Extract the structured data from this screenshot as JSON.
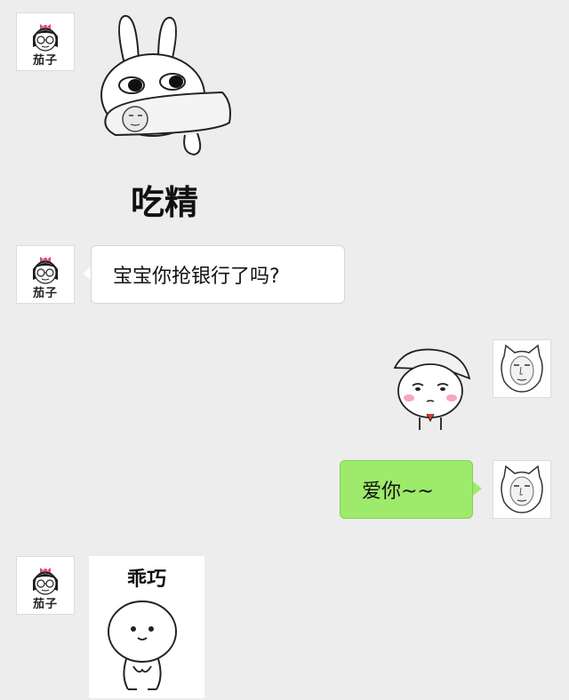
{
  "contacts": {
    "friend": {
      "name": "茄子",
      "avatar_icon": "girl-glasses-avatar-icon"
    },
    "me": {
      "avatar_icon": "cat-face-avatar-icon"
    }
  },
  "messages": [
    {
      "sender": "friend",
      "type": "sticker",
      "sticker_icon": "rabbit-holding-icon",
      "caption": "吃精"
    },
    {
      "sender": "friend",
      "type": "text",
      "text": "宝宝你抢银行了吗?"
    },
    {
      "sender": "me",
      "type": "sticker",
      "sticker_icon": "bashful-cap-character-icon"
    },
    {
      "sender": "me",
      "type": "text",
      "text": "爱你~~"
    },
    {
      "sender": "friend",
      "type": "sticker",
      "sticker_icon": "round-blob-character-icon",
      "caption": "乖巧"
    }
  ],
  "colors": {
    "background": "#ededed",
    "sent_bubble": "#9eea6a",
    "received_bubble": "#ffffff"
  }
}
